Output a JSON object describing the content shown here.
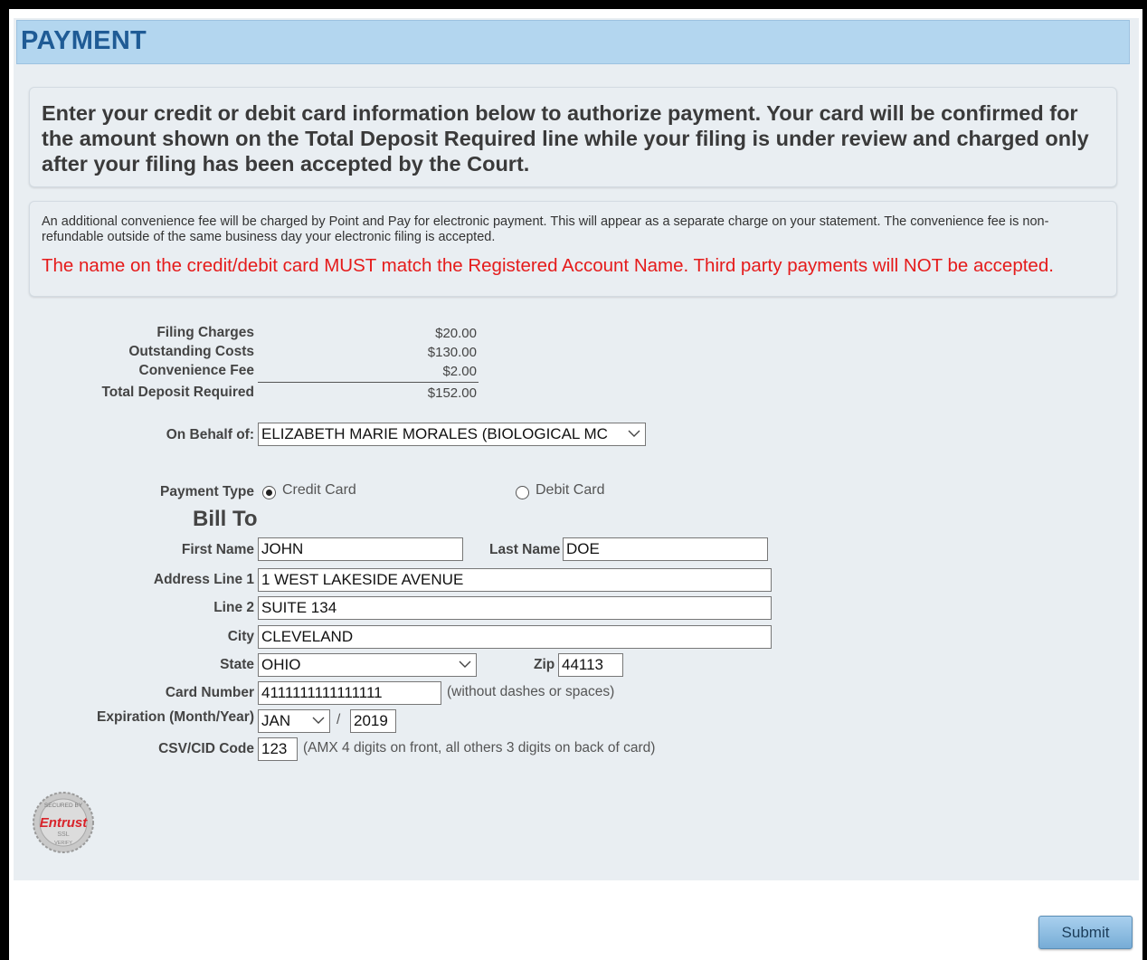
{
  "header": {
    "title": "PAYMENT"
  },
  "intro": {
    "text": "Enter your credit or debit card information below to authorize payment. Your card will be confirmed for the amount shown on the Total Deposit Required line while your filing is under review and charged only after your filing has been accepted by the Court."
  },
  "notice": {
    "fee_text": "An additional convenience fee will be charged by Point and Pay for electronic payment. This will appear as a separate charge on your statement. The convenience fee is non-refundable outside of the same business day your electronic filing is accepted.",
    "warning": "The name on the credit/debit card MUST match the Registered Account Name. Third party payments will NOT be accepted.",
    "warning_color": "#e51b1b"
  },
  "charges": {
    "filing_label": "Filing Charges",
    "filing_amount": "$20.00",
    "outstanding_label": "Outstanding Costs",
    "outstanding_amount": "$130.00",
    "convenience_label": "Convenience Fee",
    "convenience_amount": "$2.00",
    "total_label": "Total Deposit Required",
    "total_amount": "$152.00"
  },
  "behalf": {
    "label": "On Behalf of:",
    "selected": "ELIZABETH MARIE MORALES (BIOLOGICAL MC"
  },
  "payment_type": {
    "label": "Payment Type",
    "credit_label": "Credit Card",
    "debit_label": "Debit Card",
    "selected": "credit"
  },
  "bill_to": {
    "heading": "Bill To",
    "first_name_label": "First Name",
    "first_name": "JOHN",
    "last_name_label": "Last Name",
    "last_name": "DOE",
    "address1_label": "Address Line 1",
    "address1": "1 WEST LAKESIDE AVENUE",
    "line2_label": "Line 2",
    "line2": "SUITE 134",
    "city_label": "City",
    "city": "CLEVELAND",
    "state_label": "State",
    "state": "OHIO",
    "zip_label": "Zip",
    "zip": "44113",
    "card_number_label": "Card Number",
    "card_number": "4111111111111111",
    "card_number_hint": "(without dashes or spaces)",
    "expiration_label": "Expiration (Month/Year)",
    "exp_month": "JAN",
    "exp_separator": "/",
    "exp_year": "2019",
    "csv_label": "CSV/CID Code",
    "csv": "123",
    "csv_hint": "(AMX 4 digits on front, all others 3 digits on back of card)"
  },
  "seal": {
    "icon": "entrust-ssl-seal-icon",
    "brand": "Entrust",
    "top_text": "SECURED BY",
    "sub_text": "SSL",
    "bottom_text": "VERIFY"
  },
  "actions": {
    "submit_label": "Submit"
  },
  "colors": {
    "header_bg": "#b3d6ef",
    "title": "#1f5b95",
    "panel_bg": "#e9eef2",
    "warning": "#e51b1b"
  }
}
